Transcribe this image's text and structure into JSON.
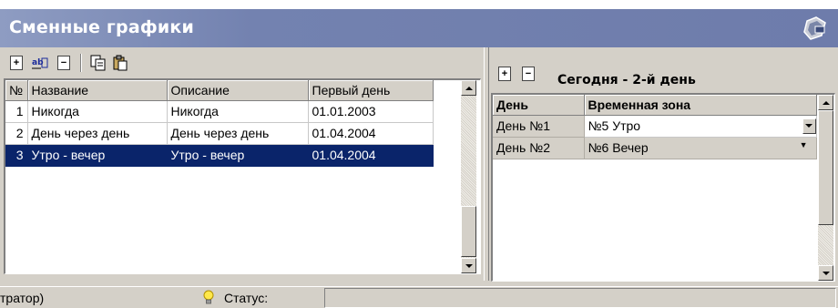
{
  "window": {
    "title": "Сменные графики",
    "app_icon": "toolbox-icon"
  },
  "left_toolbar": {
    "buttons": [
      {
        "name": "add-record-button",
        "icon": "new-document-icon",
        "glyph": "+"
      },
      {
        "name": "rename-button",
        "icon": "ab-rename-icon",
        "glyph": "ab"
      },
      {
        "name": "delete-record-button",
        "icon": "delete-document-icon",
        "glyph": "−"
      },
      {
        "name": "copy-button",
        "icon": "copy-icon"
      },
      {
        "name": "paste-button",
        "icon": "paste-icon"
      }
    ]
  },
  "schedules_table": {
    "columns": [
      "№",
      "Название",
      "Описание",
      "Первый день"
    ],
    "rows": [
      {
        "num": "1",
        "name": "Никогда",
        "description": "Никогда",
        "first_day": "01.01.2003"
      },
      {
        "num": "2",
        "name": "День через день",
        "description": "День через день",
        "first_day": "01.04.2004"
      },
      {
        "num": "3",
        "name": "Утро - вечер",
        "description": "Утро - вечер",
        "first_day": "01.04.2004"
      }
    ],
    "selected_row": 3
  },
  "right_panel": {
    "title": "Сегодня - 2-й день",
    "columns": [
      "День",
      "Временная зона"
    ],
    "rows": [
      {
        "day": "День №1",
        "zone": "№5 Утро"
      },
      {
        "day": "День №2",
        "zone": "№6 Вечер"
      }
    ]
  },
  "statusbar": {
    "user_text": "тратор)",
    "status_label": "Статус:",
    "status_icon": "lightbulb-icon",
    "status_value": ""
  },
  "colors": {
    "title_gradient_start": "#8e9cc2",
    "title_gradient_end": "#6e7cab",
    "selection": "#0a246a",
    "face": "#d4d0c8"
  }
}
